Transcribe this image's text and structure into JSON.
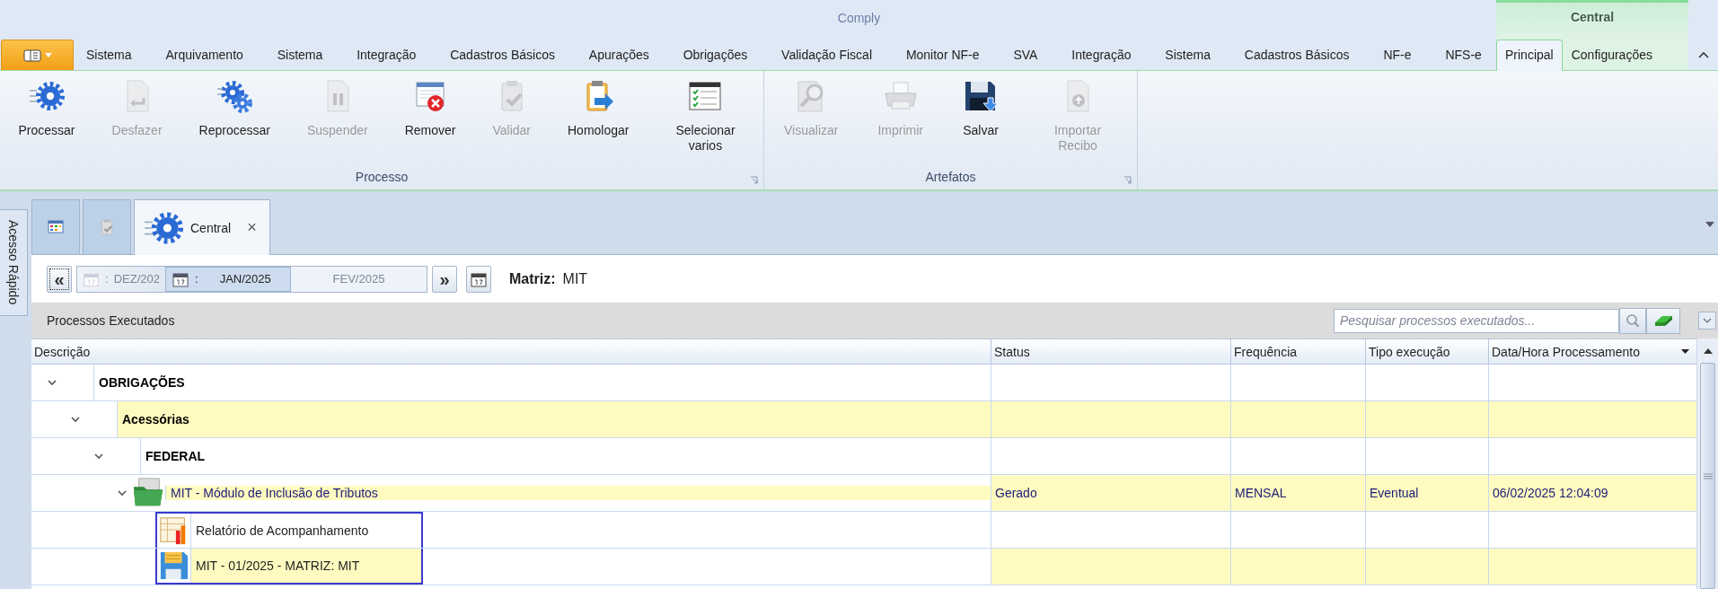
{
  "window": {
    "title": "Comply"
  },
  "context_group": {
    "label": "Central"
  },
  "ribbon_tabs": [
    {
      "label": "Sistema",
      "selected": false,
      "context": false
    },
    {
      "label": "Arquivamento",
      "selected": false,
      "context": false
    },
    {
      "label": "Sistema",
      "selected": false,
      "context": false
    },
    {
      "label": "Integração",
      "selected": false,
      "context": false
    },
    {
      "label": "Cadastros Básicos",
      "selected": false,
      "context": false
    },
    {
      "label": "Apurações",
      "selected": false,
      "context": false
    },
    {
      "label": "Obrigações",
      "selected": false,
      "context": false
    },
    {
      "label": "Validação Fiscal",
      "selected": false,
      "context": false
    },
    {
      "label": "Monitor NF-e",
      "selected": false,
      "context": false
    },
    {
      "label": "SVA",
      "selected": false,
      "context": false
    },
    {
      "label": "Integração",
      "selected": false,
      "context": false
    },
    {
      "label": "Sistema",
      "selected": false,
      "context": false
    },
    {
      "label": "Cadastros Básicos",
      "selected": false,
      "context": false
    },
    {
      "label": "NF-e",
      "selected": false,
      "context": false
    },
    {
      "label": "NFS-e",
      "selected": false,
      "context": false
    },
    {
      "label": "Principal",
      "selected": true,
      "context": true
    },
    {
      "label": "Configurações",
      "selected": false,
      "context": true
    }
  ],
  "ribbon_groups": [
    {
      "label": "Processo",
      "buttons": [
        {
          "label": "Processar",
          "kind": "gear",
          "disabled": false
        },
        {
          "label": "Desfazer",
          "kind": "undo",
          "disabled": true
        },
        {
          "label": "Reprocessar",
          "kind": "gears",
          "disabled": false
        },
        {
          "label": "Suspender",
          "kind": "pause",
          "disabled": true
        },
        {
          "label": "Remover",
          "kind": "remove",
          "disabled": false
        },
        {
          "label": "Validar",
          "kind": "validate",
          "disabled": true
        },
        {
          "label": "Homologar",
          "kind": "approve",
          "disabled": false
        },
        {
          "label": "Selecionar varios",
          "kind": "checklist",
          "disabled": false
        }
      ]
    },
    {
      "label": "Artefatos",
      "buttons": [
        {
          "label": "Visualizar",
          "kind": "view",
          "disabled": true
        },
        {
          "label": "Imprimir",
          "kind": "print",
          "disabled": true
        },
        {
          "label": "Salvar",
          "kind": "save",
          "disabled": false
        },
        {
          "label": "Importar Recibo",
          "kind": "upload",
          "disabled": true
        }
      ]
    }
  ],
  "quick_access": {
    "label": "Acesso Rápido"
  },
  "doc_tabs": [
    {
      "kind": "grid",
      "selected": false
    },
    {
      "kind": "checklist",
      "selected": false
    },
    {
      "kind": "gear",
      "label": "Central",
      "close": "×",
      "selected": true
    }
  ],
  "date_nav": {
    "prev": "«",
    "next": "»",
    "months": [
      {
        "prefix": ":",
        "label": "DEZ/202",
        "selected": false
      },
      {
        "prefix": ":",
        "label": "JAN/2025",
        "selected": true
      },
      {
        "label": "FEV/2025",
        "selected": false
      }
    ],
    "company_label": "Matriz:",
    "company": "MIT"
  },
  "panel": {
    "title": "Processos Executados",
    "search": {
      "placeholder": "Pesquisar processos executados..."
    }
  },
  "grid": {
    "columns": [
      "Descrição",
      "Status",
      "Frequência",
      "Tipo execução",
      "Data/Hora Processamento"
    ],
    "rows": [
      {
        "label": "OBRIGAÇÕES",
        "kind": "group",
        "expanded": true,
        "selected": false,
        "children": [
          {
            "label": "Acessórias",
            "kind": "group",
            "expanded": true,
            "selected": false,
            "children": [
              {
                "label": "FEDERAL",
                "kind": "group",
                "expanded": true,
                "selected": false,
                "children": [
                  {
                    "label": "MIT - Módulo de Inclusão de Tributos",
                    "kind": "folder",
                    "expanded": true,
                    "selected": false,
                    "status": "Gerado",
                    "frequency": "MENSAL",
                    "execution_type": "Eventual",
                    "processed_at": "06/02/2025 12:04:09",
                    "children": [
                      {
                        "label": "Relatório de Acompanhamento",
                        "kind": "report",
                        "selected": true
                      },
                      {
                        "label": "MIT - 01/2025 - MATRIZ: MIT",
                        "kind": "file",
                        "selected": true
                      }
                    ]
                  }
                ]
              }
            ]
          }
        ]
      }
    ]
  }
}
